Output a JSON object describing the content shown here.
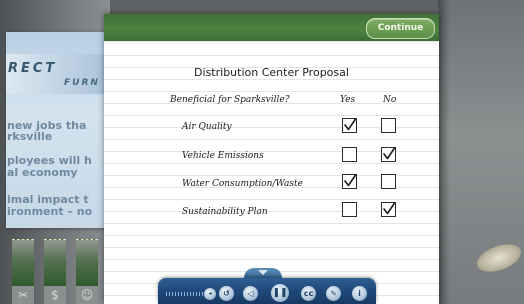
{
  "background": {
    "poster": {
      "title": "RECT",
      "subtitle": "FURN",
      "lines": [
        "new jobs tha",
        "rksville",
        "ployees will h",
        "al economy",
        "imal impact t",
        "ironment – no"
      ]
    }
  },
  "notepad": {
    "continue_label": "Continue",
    "title": "Distribution Center Proposal",
    "question": "Beneficial for Sparksville?",
    "yes_label": "Yes",
    "no_label": "No",
    "criteria": [
      {
        "label": "Air Quality",
        "yes": true,
        "no": false
      },
      {
        "label": "Vehicle Emissions",
        "yes": false,
        "no": true
      },
      {
        "label": "Water Consumption/Waste",
        "yes": true,
        "no": false
      },
      {
        "label": "Sustainability Plan",
        "yes": false,
        "no": true
      }
    ]
  },
  "colors": {
    "header_green": "#4d8442",
    "toolbar_blue": "#1e4677"
  }
}
